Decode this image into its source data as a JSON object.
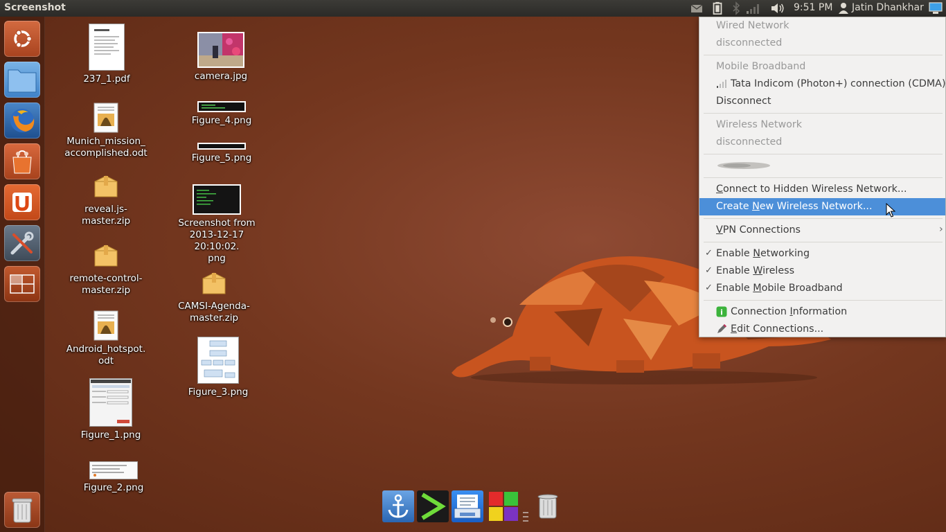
{
  "panel": {
    "title": "Screenshot",
    "clock": "9:51 PM",
    "user": "Jatin Dhankhar"
  },
  "desktop": {
    "icons": [
      {
        "label": "237_1.pdf"
      },
      {
        "label": "Munich_mission_\naccomplished.odt"
      },
      {
        "label": "reveal.js-master.zip"
      },
      {
        "label": "remote-control-\nmaster.zip"
      },
      {
        "label": "Android_hotspot.\nodt"
      },
      {
        "label": "Figure_1.png"
      },
      {
        "label": "Figure_2.png"
      },
      {
        "label": "camera.jpg"
      },
      {
        "label": "Figure_4.png"
      },
      {
        "label": "Figure_5.png"
      },
      {
        "label": "Screenshot from\n2013-12-17 20:10:02.\npng"
      },
      {
        "label": "CAMSI-Agenda-\nmaster.zip"
      },
      {
        "label": "Figure_3.png"
      }
    ]
  },
  "menu": {
    "wired_header": "Wired Network",
    "wired_status": "disconnected",
    "mobile_header": "Mobile Broadband",
    "mobile_connection": "Tata Indicom (Photon+) connection (CDMA)",
    "disconnect": "Disconnect",
    "wireless_header": "Wireless Network",
    "wireless_status": "disconnected",
    "hidden_pre": "C",
    "hidden_rest": "onnect to Hidden Wireless Network...",
    "create_pre": "Create ",
    "create_u": "N",
    "create_rest": "ew Wireless Network...",
    "vpn_u": "V",
    "vpn_rest": "PN Connections",
    "en_net_pre": "Enable ",
    "en_net_u": "N",
    "en_net_rest": "etworking",
    "en_wl_pre": "Enable ",
    "en_wl_u": "W",
    "en_wl_rest": "ireless",
    "en_mb_pre": "Enable ",
    "en_mb_u": "M",
    "en_mb_rest": "obile Broadband",
    "info_pre": "Connection ",
    "info_u": "I",
    "info_rest": "nformation",
    "edit_pre": "",
    "edit_u": "E",
    "edit_rest": "dit Connections...",
    "check_glyph": "✓",
    "submenu_arrow": "›"
  },
  "colors": {
    "highlight": "#4c8fd9",
    "panel": "#3c3b37"
  }
}
